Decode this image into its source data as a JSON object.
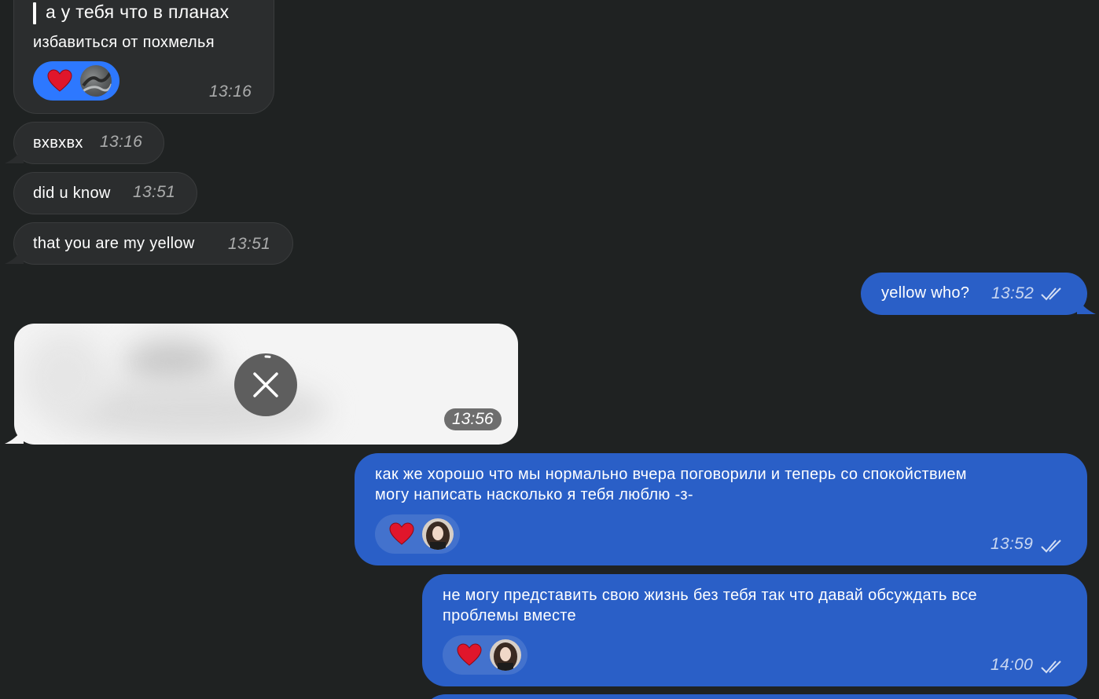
{
  "messages": [
    {
      "id": "m1",
      "direction": "incoming",
      "reply_preview": "а у тебя что в планах",
      "text": "избавиться от похмелья",
      "time": "13:16",
      "reaction": {
        "emoji": "heart-icon",
        "style": "active"
      }
    },
    {
      "id": "m2",
      "direction": "incoming",
      "text": "вхвхвх",
      "time": "13:16"
    },
    {
      "id": "m3",
      "direction": "incoming",
      "text": "did u know",
      "time": "13:51"
    },
    {
      "id": "m4",
      "direction": "incoming",
      "text": "that you are my yellow",
      "time": "13:51"
    },
    {
      "id": "m5",
      "direction": "outgoing",
      "text": "yellow who?",
      "time": "13:52",
      "read": true
    },
    {
      "id": "m6",
      "direction": "incoming",
      "type": "media-loading",
      "time": "13:56"
    },
    {
      "id": "m7",
      "direction": "outgoing",
      "text_lines": [
        "как же хорошо что мы нормально вчера поговорили и теперь со спокойствием",
        "могу написать насколько я тебя люблю -з-"
      ],
      "time": "13:59",
      "read": true,
      "reaction": {
        "emoji": "heart-icon",
        "style": "passive"
      }
    },
    {
      "id": "m8",
      "direction": "outgoing",
      "text_lines": [
        "не могу представить свою жизнь без тебя так что давай обсуждать все",
        "проблемы вместе"
      ],
      "time": "14:00",
      "read": true,
      "reaction": {
        "emoji": "heart-icon",
        "style": "passive"
      }
    }
  ],
  "colors": {
    "background": "#1f2222",
    "incoming_bubble": "#2b2d2e",
    "outgoing_bubble": "#2a5fc7",
    "reaction_active": "#2d78ff",
    "heart": "#e0162b"
  }
}
